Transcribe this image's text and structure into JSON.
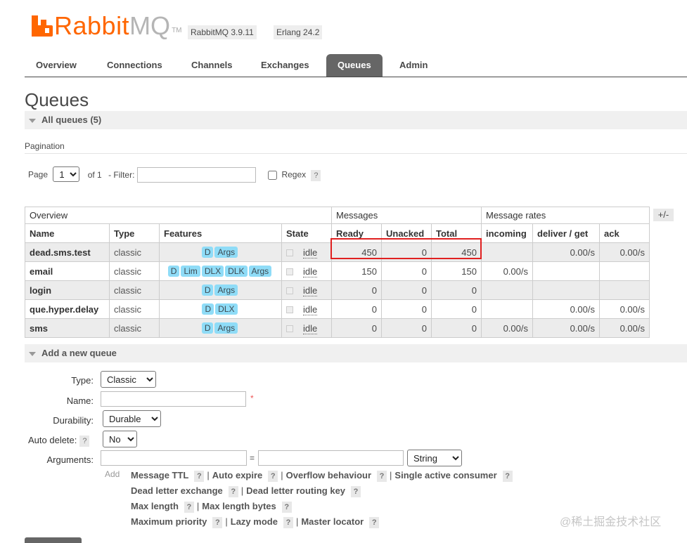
{
  "header": {
    "logo_rabbit": "Rabbit",
    "logo_mq": "MQ",
    "logo_tm": "TM",
    "version": "RabbitMQ 3.9.11",
    "erlang": "Erlang 24.2"
  },
  "tabs": [
    {
      "label": "Overview"
    },
    {
      "label": "Connections"
    },
    {
      "label": "Channels"
    },
    {
      "label": "Exchanges"
    },
    {
      "label": "Queues",
      "active": true
    },
    {
      "label": "Admin"
    }
  ],
  "page_title": "Queues",
  "all_queues": "All queues (5)",
  "pagination": {
    "title": "Pagination",
    "page_label": "Page",
    "page_value": "1",
    "of_label": "of 1",
    "filter_label": "- Filter:",
    "filter_value": "",
    "regex_label": "Regex",
    "help": "?"
  },
  "table": {
    "group_headers": {
      "overview": "Overview",
      "messages": "Messages",
      "rates": "Message rates"
    },
    "plus_minus": "+/-",
    "columns": [
      "Name",
      "Type",
      "Features",
      "State",
      "Ready",
      "Unacked",
      "Total",
      "incoming",
      "deliver / get",
      "ack"
    ],
    "rows": [
      {
        "name": "dead.sms.test",
        "type": "classic",
        "features": [
          "D",
          "Args"
        ],
        "state": "idle",
        "ready": "450",
        "unacked": "0",
        "total": "450",
        "incoming": "",
        "deliver": "0.00/s",
        "ack": "0.00/s"
      },
      {
        "name": "email",
        "type": "classic",
        "features": [
          "D",
          "Lim",
          "DLX",
          "DLK",
          "Args"
        ],
        "state": "idle",
        "ready": "150",
        "unacked": "0",
        "total": "150",
        "incoming": "0.00/s",
        "deliver": "",
        "ack": ""
      },
      {
        "name": "login",
        "type": "classic",
        "features": [
          "D",
          "Args"
        ],
        "state": "idle",
        "ready": "0",
        "unacked": "0",
        "total": "0",
        "incoming": "",
        "deliver": "",
        "ack": ""
      },
      {
        "name": "que.hyper.delay",
        "type": "classic",
        "features": [
          "D",
          "DLX"
        ],
        "state": "idle",
        "ready": "0",
        "unacked": "0",
        "total": "0",
        "incoming": "",
        "deliver": "0.00/s",
        "ack": "0.00/s"
      },
      {
        "name": "sms",
        "type": "classic",
        "features": [
          "D",
          "Args"
        ],
        "state": "idle",
        "ready": "0",
        "unacked": "0",
        "total": "0",
        "incoming": "0.00/s",
        "deliver": "0.00/s",
        "ack": "0.00/s"
      }
    ]
  },
  "add_queue": {
    "title": "Add a new queue",
    "type_label": "Type:",
    "type_value": "Classic",
    "name_label": "Name:",
    "name_value": "",
    "required_mark": "*",
    "durability_label": "Durability:",
    "durability_value": "Durable",
    "auto_delete_label": "Auto delete:",
    "auto_delete_value": "No",
    "arguments_label": "Arguments:",
    "equals": "=",
    "arg_type_value": "String",
    "add_label": "Add",
    "help": "?",
    "arg_links": [
      [
        "Message TTL",
        "Auto expire",
        "Overflow behaviour",
        "Single active consumer"
      ],
      [
        "Dead letter exchange",
        "Dead letter routing key"
      ],
      [
        "Max length",
        "Max length bytes"
      ],
      [
        "Maximum priority",
        "Lazy mode",
        "Master locator"
      ]
    ]
  },
  "watermark": "@稀土掘金技术社区",
  "colors": {
    "brand": "#ff6600",
    "active_tab": "#666666",
    "feature_chip": "#8fdcf7",
    "highlight": "#e02020"
  }
}
